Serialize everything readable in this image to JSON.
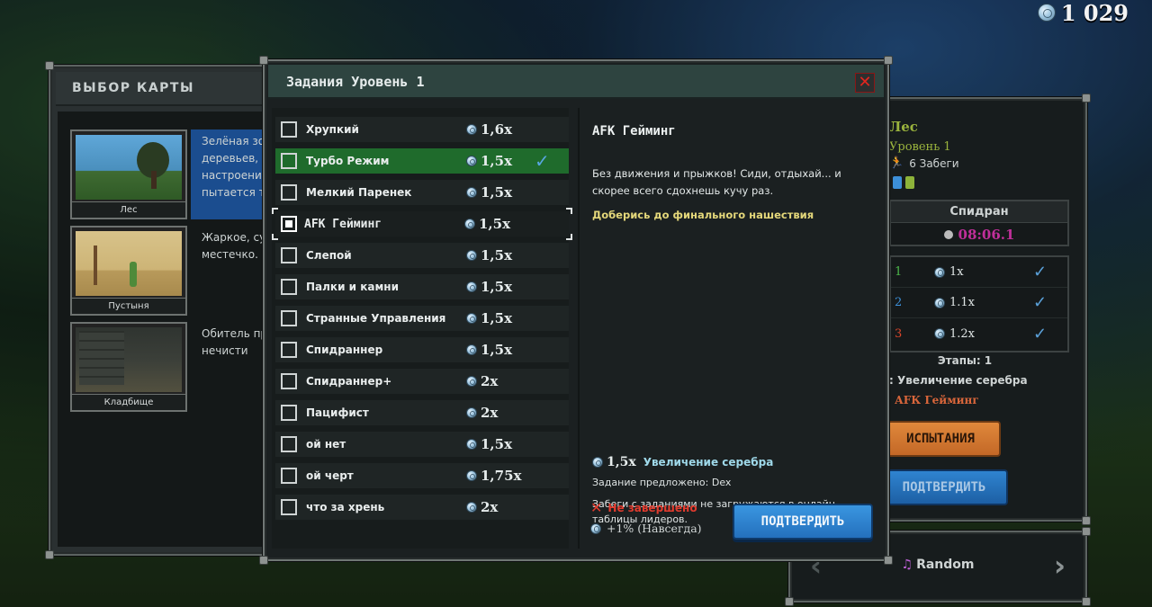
{
  "currency": {
    "icon": "silver-coin-icon",
    "amount": "1 029"
  },
  "map_select": {
    "title": "ВЫБОР КАРТЫ",
    "maps": [
      {
        "name": "Лес",
        "description": "Зелёная зо\nдеревьев,\nнастроени\nпытается т",
        "selected": true
      },
      {
        "name": "Пустыня",
        "description": "Жаркое, су\nместечко."
      },
      {
        "name": "Кладбище",
        "description": "Обитель пр\nнечисти"
      }
    ]
  },
  "map_info": {
    "name": "Лес",
    "level": "Уровень 1",
    "runs": "6 Забеги",
    "speedrun": {
      "title": "Спидран",
      "time": "08:06.1"
    },
    "stages": [
      {
        "num": "1",
        "num_color": "#4bb84a",
        "mult": "1x"
      },
      {
        "num": "2",
        "num_color": "#3c8fd8",
        "mult": "1.1x"
      },
      {
        "num": "3",
        "num_color": "#d9462b",
        "mult": "1.2x"
      }
    ],
    "stages_label": "Этапы: 1",
    "bonus": ": Увеличение серебра",
    "task": "АFК Гейминг",
    "trials_button": "ИСПЫТАНИЯ",
    "confirm_button": "ПОДТВЕРДИТЬ"
  },
  "music": {
    "icon": "music-note-icon",
    "title": "Random",
    "prev_icon": "chevron-left-icon",
    "next_icon": "chevron-right-icon"
  },
  "dialog": {
    "title": "Задания Уровень 1",
    "close_icon": "close-icon",
    "tasks": [
      {
        "name": "Хрупкий",
        "mult": "1,6x"
      },
      {
        "name": "Турбо Режим",
        "mult": "1,5x",
        "state": "selected"
      },
      {
        "name": "Мелкий Паренек",
        "mult": "1,5x"
      },
      {
        "name": "АFК Гейминг",
        "mult": "1,5x",
        "state": "focus"
      },
      {
        "name": "Слепой",
        "mult": "1,5x"
      },
      {
        "name": "Палки и камни",
        "mult": "1,5x"
      },
      {
        "name": "Странные Управления",
        "mult": "1,5x"
      },
      {
        "name": "Спидраннер",
        "mult": "1,5x"
      },
      {
        "name": "Спидраннер+",
        "mult": "2x"
      },
      {
        "name": "Пацифист",
        "mult": "2x"
      },
      {
        "name": "ой нет",
        "mult": "1,5x"
      },
      {
        "name": "ой черт",
        "mult": "1,75x"
      },
      {
        "name": "что за хрень",
        "mult": "2x"
      }
    ],
    "detail": {
      "title": "АFК Гейминг",
      "description": "Без движения и прыжков! Сиди, отдыхай... и скорее всего сдохнешь кучу раз.",
      "goal": "Доберись до финального нашествия",
      "bonus_mult": "1,5x",
      "bonus_label": "Увеличение серебра",
      "author": "Задание предложено: Dex",
      "note": "Забеги с заданиями не загружаются в онлайн таблицы лидеров.",
      "status": "Не завершено",
      "permanent": "+1% (Навсегда)",
      "submit_button": "ПОДТВЕРДИТЬ"
    }
  }
}
